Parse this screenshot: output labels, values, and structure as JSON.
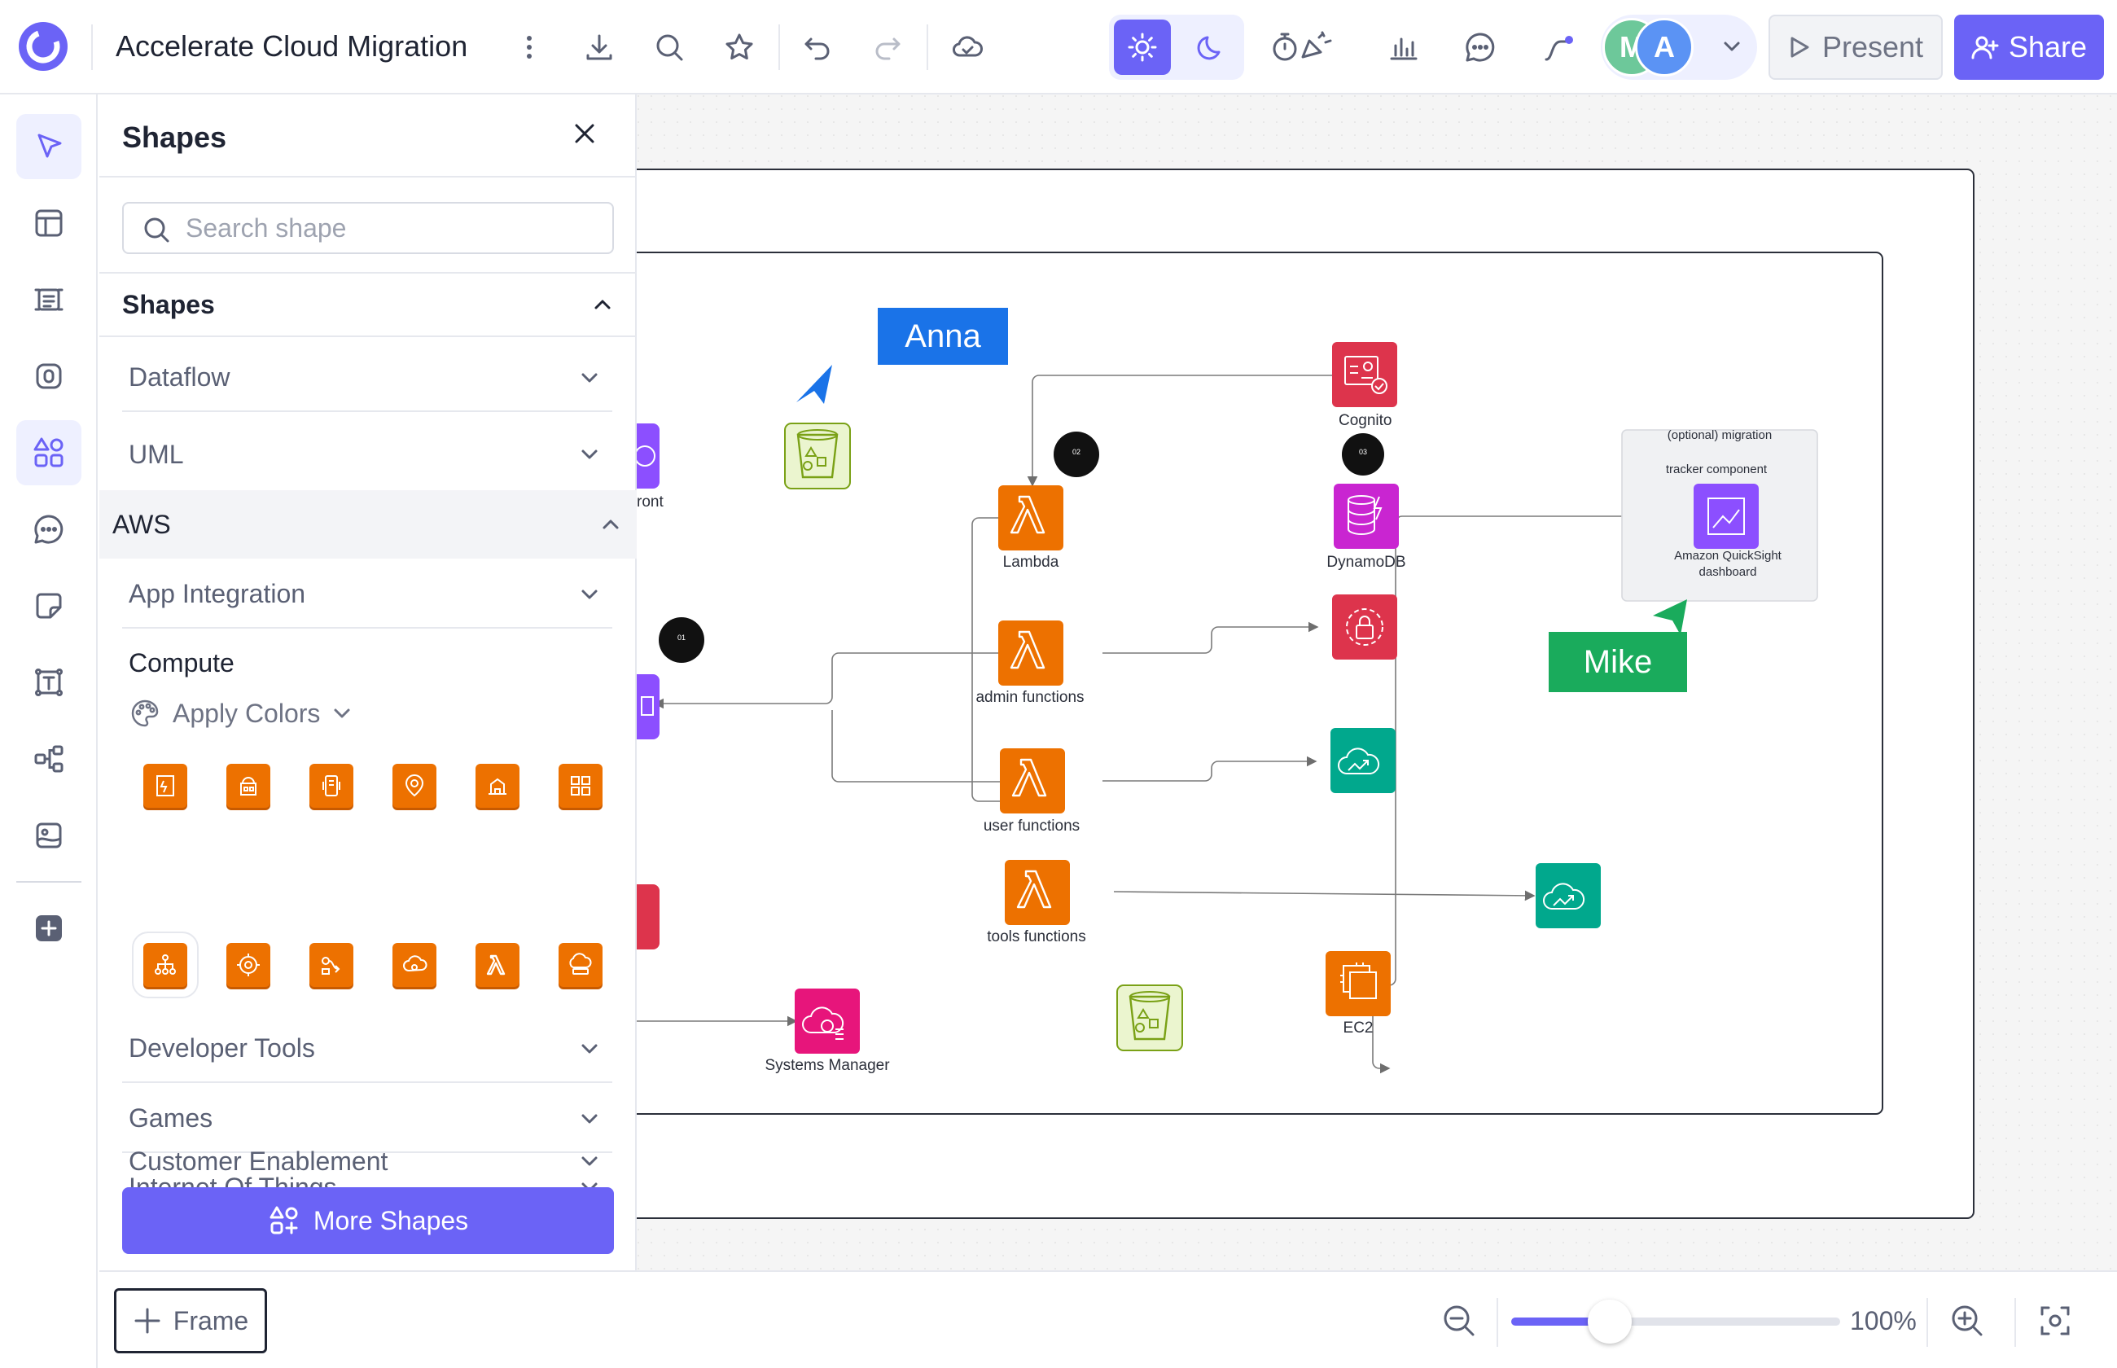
{
  "header": {
    "title": "Accelerate Cloud Migration",
    "avatars": [
      {
        "initial": "M",
        "color": "#6dc89a"
      },
      {
        "initial": "A",
        "color": "#5b93f4"
      }
    ],
    "present_label": "Present",
    "share_label": "Share",
    "accent_color": "#6b63f6"
  },
  "panel": {
    "title": "Shapes",
    "search_placeholder": "Search shape",
    "section_shapes": "Shapes",
    "categories_top": [
      "Dataflow",
      "UML"
    ],
    "aws_label": "AWS",
    "app_integration": "App Integration",
    "compute_label": "Compute",
    "apply_colors": "Apply Colors",
    "categories_bottom": [
      "Developer Tools",
      "Games",
      "Internet Of Things",
      "Customer Enablement"
    ],
    "more_shapes": "More Shapes"
  },
  "diagram": {
    "nodes": {
      "cognito": "Cognito",
      "lambda": "Lambda",
      "dynamodb": "DynamoDB",
      "admin": "admin functions",
      "user": "user functions",
      "tools": "tools functions",
      "ec2": "EC2",
      "systems_manager": "Systems Manager",
      "cloudfront_partial": "ront",
      "quicksight": "Amazon QuickSight dashboard",
      "quicksight_line1": "Amazon QuickSight",
      "quicksight_line2": "dashboard",
      "group_line1": "(optional) migration",
      "group_line2": "tracker component"
    },
    "markers": [
      "01",
      "02",
      "03"
    ],
    "cursors": [
      {
        "name": "Anna",
        "color": "#1a73e8"
      },
      {
        "name": "Mike",
        "color": "#1aab5c"
      }
    ]
  },
  "footer": {
    "frame_label": "Frame",
    "zoom_value": "100%",
    "zoom_level": 0.3
  }
}
